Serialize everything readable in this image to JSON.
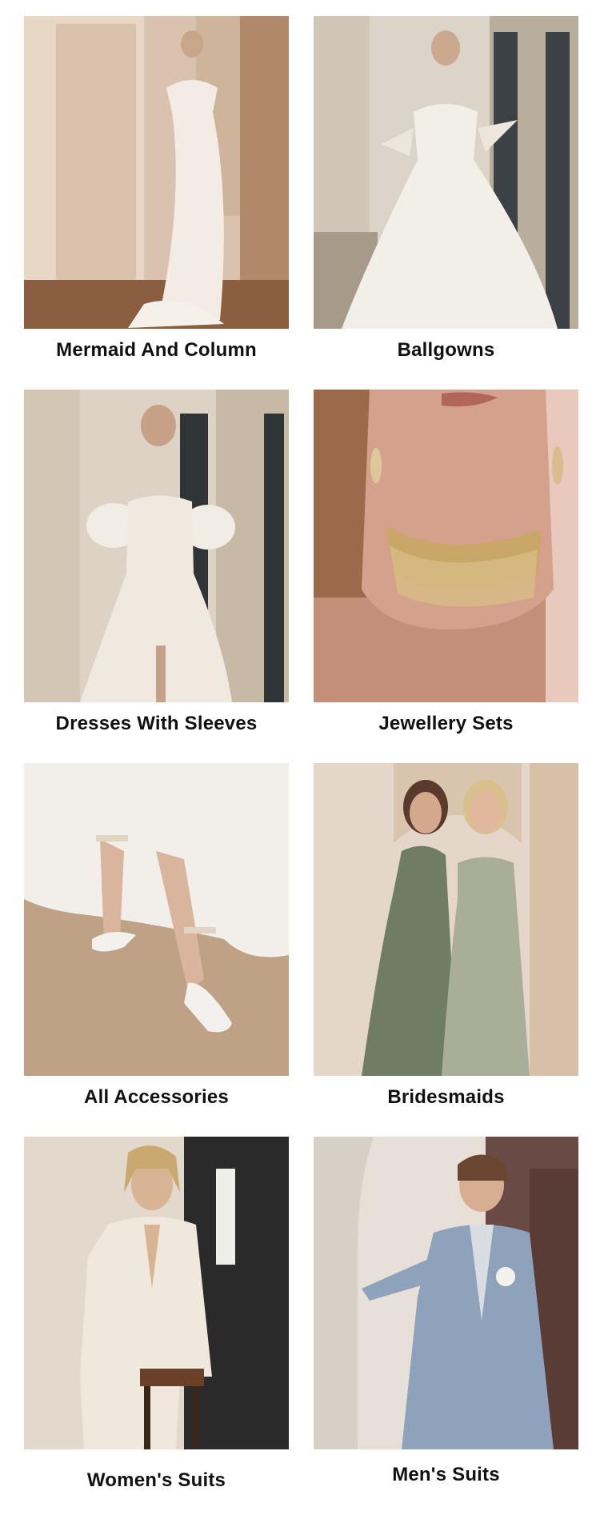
{
  "categories": [
    {
      "label": "Mermaid And Column"
    },
    {
      "label": "Ballgowns"
    },
    {
      "label": "Dresses With Sleeves"
    },
    {
      "label": "Jewellery Sets"
    },
    {
      "label": "All Accessories"
    },
    {
      "label": "Bridesmaids"
    },
    {
      "label": "Women's Suits"
    },
    {
      "label": "Men's Suits"
    }
  ]
}
